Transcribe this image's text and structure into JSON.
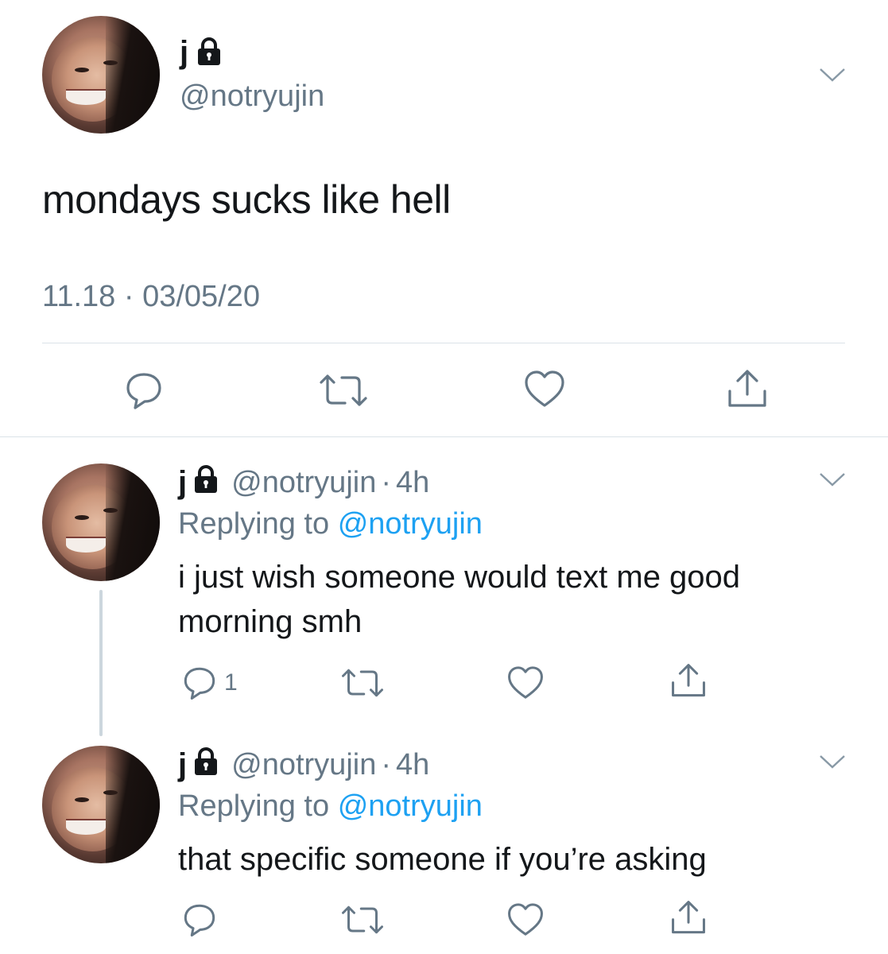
{
  "main_tweet": {
    "display_name": "j",
    "handle": "@notryujin",
    "text": "mondays sucks like hell",
    "time": "11.18",
    "separator": "·",
    "date": "03/05/20"
  },
  "replies": [
    {
      "display_name": "j",
      "handle": "@notryujin",
      "separator": "·",
      "age": "4h",
      "replying_label": "Replying to",
      "replying_to": "@notryujin",
      "text": "i just wish someone would text me good morning smh",
      "reply_count": "1"
    },
    {
      "display_name": "j",
      "handle": "@notryujin",
      "separator": "·",
      "age": "4h",
      "replying_label": "Replying to",
      "replying_to": "@notryujin",
      "text": "that specific someone if you’re asking",
      "reply_count": ""
    }
  ],
  "icons": {
    "reply": "reply-icon",
    "retweet": "retweet-icon",
    "like": "heart-icon",
    "share": "share-icon",
    "lock": "lock-icon",
    "more": "chevron-down-icon"
  },
  "colors": {
    "text": "#14171a",
    "secondary": "#657786",
    "link": "#1da1f2",
    "divider": "#dbe2e8",
    "thread_line": "#ccd6dd"
  }
}
